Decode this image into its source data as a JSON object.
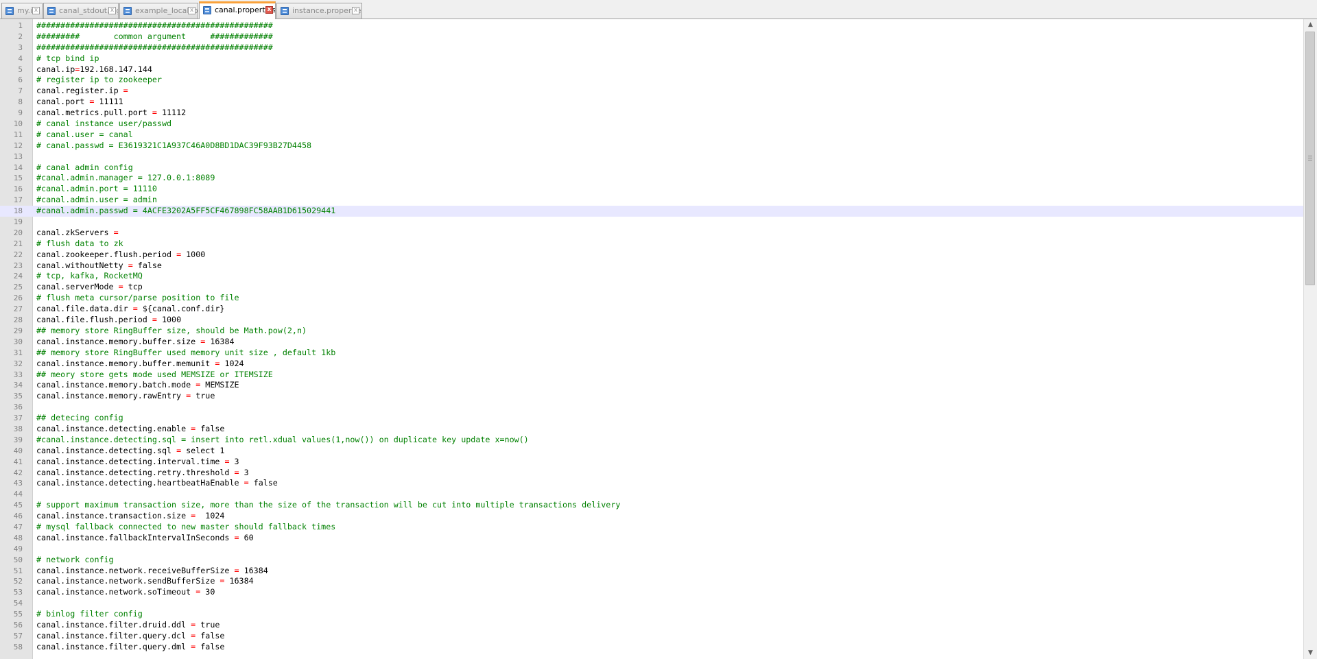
{
  "tabs": [
    {
      "label": "my.ini",
      "active": false
    },
    {
      "label": "canal_stdout.log",
      "active": false
    },
    {
      "label": "example_local.log",
      "active": false
    },
    {
      "label": "canal.properties",
      "active": true
    },
    {
      "label": "instance.properties",
      "active": false
    }
  ],
  "editor": {
    "current_line": 18,
    "lines": [
      {
        "n": "1",
        "t": "#################################################"
      },
      {
        "n": "2",
        "t": "#########       common argument     #############"
      },
      {
        "n": "3",
        "t": "#################################################"
      },
      {
        "n": "4",
        "t": "# tcp bind ip"
      },
      {
        "n": "5",
        "t": "canal.ip=192.168.147.144"
      },
      {
        "n": "6",
        "t": "# register ip to zookeeper"
      },
      {
        "n": "7",
        "t": "canal.register.ip ="
      },
      {
        "n": "8",
        "t": "canal.port = 11111"
      },
      {
        "n": "9",
        "t": "canal.metrics.pull.port = 11112"
      },
      {
        "n": "10",
        "t": "# canal instance user/passwd"
      },
      {
        "n": "11",
        "t": "# canal.user = canal"
      },
      {
        "n": "12",
        "t": "# canal.passwd = E3619321C1A937C46A0D8BD1DAC39F93B27D4458"
      },
      {
        "n": "13",
        "t": ""
      },
      {
        "n": "14",
        "t": "# canal admin config"
      },
      {
        "n": "15",
        "t": "#canal.admin.manager = 127.0.0.1:8089"
      },
      {
        "n": "16",
        "t": "#canal.admin.port = 11110"
      },
      {
        "n": "17",
        "t": "#canal.admin.user = admin"
      },
      {
        "n": "18",
        "t": "#canal.admin.passwd = 4ACFE3202A5FF5CF467898FC58AAB1D615029441"
      },
      {
        "n": "19",
        "t": ""
      },
      {
        "n": "20",
        "t": "canal.zkServers ="
      },
      {
        "n": "21",
        "t": "# flush data to zk"
      },
      {
        "n": "22",
        "t": "canal.zookeeper.flush.period = 1000"
      },
      {
        "n": "23",
        "t": "canal.withoutNetty = false"
      },
      {
        "n": "24",
        "t": "# tcp, kafka, RocketMQ"
      },
      {
        "n": "25",
        "t": "canal.serverMode = tcp"
      },
      {
        "n": "26",
        "t": "# flush meta cursor/parse position to file"
      },
      {
        "n": "27",
        "t": "canal.file.data.dir = ${canal.conf.dir}"
      },
      {
        "n": "28",
        "t": "canal.file.flush.period = 1000"
      },
      {
        "n": "29",
        "t": "## memory store RingBuffer size, should be Math.pow(2,n)"
      },
      {
        "n": "30",
        "t": "canal.instance.memory.buffer.size = 16384"
      },
      {
        "n": "31",
        "t": "## memory store RingBuffer used memory unit size , default 1kb"
      },
      {
        "n": "32",
        "t": "canal.instance.memory.buffer.memunit = 1024"
      },
      {
        "n": "33",
        "t": "## meory store gets mode used MEMSIZE or ITEMSIZE"
      },
      {
        "n": "34",
        "t": "canal.instance.memory.batch.mode = MEMSIZE"
      },
      {
        "n": "35",
        "t": "canal.instance.memory.rawEntry = true"
      },
      {
        "n": "36",
        "t": ""
      },
      {
        "n": "37",
        "t": "## detecing config"
      },
      {
        "n": "38",
        "t": "canal.instance.detecting.enable = false"
      },
      {
        "n": "39",
        "t": "#canal.instance.detecting.sql = insert into retl.xdual values(1,now()) on duplicate key update x=now()"
      },
      {
        "n": "40",
        "t": "canal.instance.detecting.sql = select 1"
      },
      {
        "n": "41",
        "t": "canal.instance.detecting.interval.time = 3"
      },
      {
        "n": "42",
        "t": "canal.instance.detecting.retry.threshold = 3"
      },
      {
        "n": "43",
        "t": "canal.instance.detecting.heartbeatHaEnable = false"
      },
      {
        "n": "44",
        "t": ""
      },
      {
        "n": "45",
        "t": "# support maximum transaction size, more than the size of the transaction will be cut into multiple transactions delivery"
      },
      {
        "n": "46",
        "t": "canal.instance.transaction.size =  1024"
      },
      {
        "n": "47",
        "t": "# mysql fallback connected to new master should fallback times"
      },
      {
        "n": "48",
        "t": "canal.instance.fallbackIntervalInSeconds = 60"
      },
      {
        "n": "49",
        "t": ""
      },
      {
        "n": "50",
        "t": "# network config"
      },
      {
        "n": "51",
        "t": "canal.instance.network.receiveBufferSize = 16384"
      },
      {
        "n": "52",
        "t": "canal.instance.network.sendBufferSize = 16384"
      },
      {
        "n": "53",
        "t": "canal.instance.network.soTimeout = 30"
      },
      {
        "n": "54",
        "t": ""
      },
      {
        "n": "55",
        "t": "# binlog filter config"
      },
      {
        "n": "56",
        "t": "canal.instance.filter.druid.ddl = true"
      },
      {
        "n": "57",
        "t": "canal.instance.filter.query.dcl = false"
      },
      {
        "n": "58",
        "t": "canal.instance.filter.query.dml = false"
      }
    ]
  },
  "scrollbar": {
    "up_glyph": "▲",
    "down_glyph": "▼",
    "position": 0.0
  },
  "colors": {
    "comment": "#008000",
    "operator": "#ff0000",
    "current_line_bg": "#e8e8ff",
    "active_tab_accent": "#f9a13a"
  },
  "icons": {
    "tab_file": "document-icon",
    "tab_close": "close-icon",
    "close_glyph": "x"
  }
}
